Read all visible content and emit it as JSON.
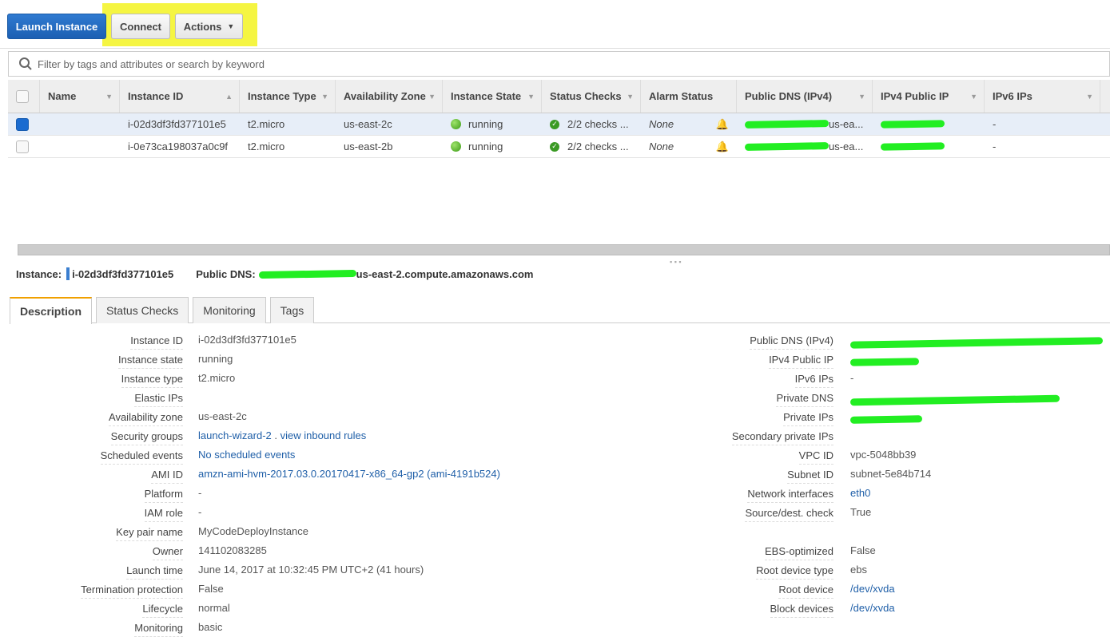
{
  "toolbar": {
    "launch": "Launch Instance",
    "connect": "Connect",
    "actions": "Actions"
  },
  "filter": {
    "placeholder": "Filter by tags and attributes or search by keyword"
  },
  "columns": [
    "Name",
    "Instance ID",
    "Instance Type",
    "Availability Zone",
    "Instance State",
    "Status Checks",
    "Alarm Status",
    "Public DNS (IPv4)",
    "IPv4 Public IP",
    "IPv6 IPs"
  ],
  "rows": [
    {
      "selected": true,
      "name": "",
      "id": "i-02d3df3fd377101e5",
      "type": "t2.micro",
      "az": "us-east-2c",
      "state": "running",
      "checks": "2/2 checks ...",
      "alarm": "None",
      "dns": "us-ea...",
      "ip": "",
      "ipv6": "-"
    },
    {
      "selected": false,
      "name": "",
      "id": "i-0e73ca198037a0c9f",
      "type": "t2.micro",
      "az": "us-east-2b",
      "state": "running",
      "checks": "2/2 checks ...",
      "alarm": "None",
      "dns": "us-ea...",
      "ip": "",
      "ipv6": "-"
    }
  ],
  "selected": {
    "instance_label": "Instance:",
    "instance_id": "i-02d3df3fd377101e5",
    "dns_label": "Public DNS:",
    "dns_suffix": "us-east-2.compute.amazonaws.com"
  },
  "tabs": [
    "Description",
    "Status Checks",
    "Monitoring",
    "Tags"
  ],
  "left": [
    {
      "label": "Instance ID",
      "value": "i-02d3df3fd377101e5"
    },
    {
      "label": "Instance state",
      "value": "running"
    },
    {
      "label": "Instance type",
      "value": "t2.micro"
    },
    {
      "label": "Elastic IPs",
      "value": ""
    },
    {
      "label": "Availability zone",
      "value": "us-east-2c"
    },
    {
      "label": "Security groups",
      "value": "launch-wizard-2",
      "link2": "view inbound rules"
    },
    {
      "label": "Scheduled events",
      "value": "No scheduled events"
    },
    {
      "label": "AMI ID",
      "value": "amzn-ami-hvm-2017.03.0.20170417-x86_64-gp2 (ami-4191b524)"
    },
    {
      "label": "Platform",
      "value": "-"
    },
    {
      "label": "IAM role",
      "value": "-"
    },
    {
      "label": "Key pair name",
      "value": "MyCodeDeployInstance"
    },
    {
      "label": "Owner",
      "value": "141102083285"
    },
    {
      "label": "Launch time",
      "value": "June 14, 2017 at 10:32:45 PM UTC+2 (41 hours)"
    },
    {
      "label": "Termination protection",
      "value": "False"
    },
    {
      "label": "Lifecycle",
      "value": "normal"
    },
    {
      "label": "Monitoring",
      "value": "basic"
    }
  ],
  "right": [
    {
      "label": "Public DNS (IPv4)",
      "value": ""
    },
    {
      "label": "IPv4 Public IP",
      "value": ""
    },
    {
      "label": "IPv6 IPs",
      "value": "-"
    },
    {
      "label": "Private DNS",
      "value": ""
    },
    {
      "label": "Private IPs",
      "value": ""
    },
    {
      "label": "Secondary private IPs",
      "value": ""
    },
    {
      "label": "VPC ID",
      "value": "vpc-5048bb39"
    },
    {
      "label": "Subnet ID",
      "value": "subnet-5e84b714"
    },
    {
      "label": "Network interfaces",
      "value": "eth0"
    },
    {
      "label": "Source/dest. check",
      "value": "True"
    },
    {
      "label": "EBS-optimized",
      "value": "False"
    },
    {
      "label": "Root device type",
      "value": "ebs"
    },
    {
      "label": "Root device",
      "value": "/dev/xvda"
    },
    {
      "label": "Block devices",
      "value": "/dev/xvda"
    }
  ]
}
